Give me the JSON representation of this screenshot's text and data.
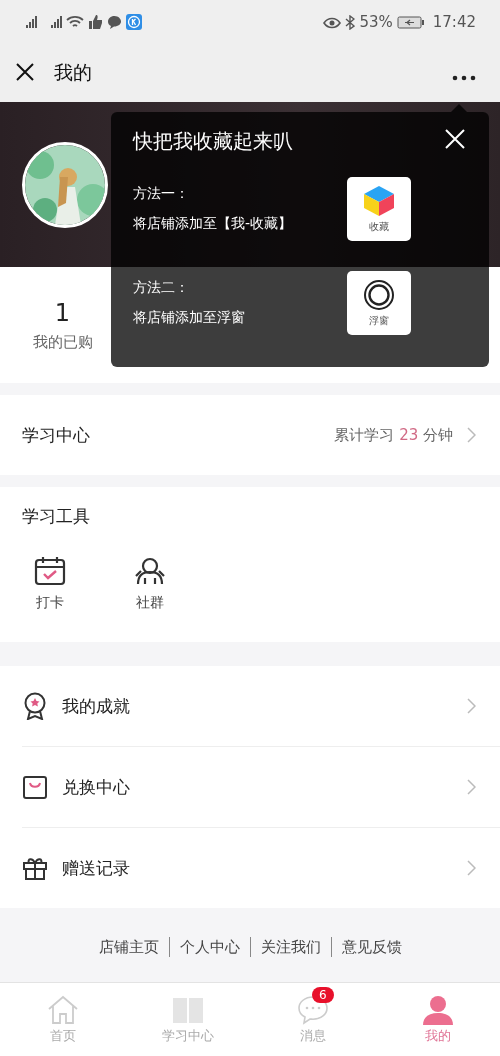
{
  "status_bar": {
    "battery": "53%",
    "time": "17:42"
  },
  "header": {
    "title": "我的"
  },
  "stats": [
    {
      "value": "1",
      "label": "我的已购"
    }
  ],
  "popup": {
    "title": "快把我收藏起来叭",
    "methods": [
      {
        "label": "方法一：",
        "text": "将店铺添加至【我-收藏】",
        "icon_label": "收藏",
        "kind": "cube"
      },
      {
        "label": "方法二：",
        "text": "将店铺添加至浮窗",
        "icon_label": "浮窗",
        "kind": "ring"
      }
    ]
  },
  "learning": {
    "title": "学习中心",
    "prefix": "累计学习",
    "minutes": "23",
    "suffix": "分钟"
  },
  "tools": {
    "title": "学习工具",
    "items": [
      {
        "label": "打卡",
        "kind": "checkin"
      },
      {
        "label": "社群",
        "kind": "group"
      }
    ]
  },
  "menu": [
    {
      "label": "我的成就",
      "kind": "medal"
    },
    {
      "label": "兑换中心",
      "kind": "bag"
    },
    {
      "label": "赠送记录",
      "kind": "gift"
    }
  ],
  "footer_links": [
    "店铺主页",
    "个人中心",
    "关注我们",
    "意见反馈"
  ],
  "tabs": [
    {
      "label": "首页",
      "kind": "home",
      "selected": false
    },
    {
      "label": "学习中心",
      "kind": "book",
      "selected": false
    },
    {
      "label": "消息",
      "kind": "chat",
      "selected": false,
      "badge": "6"
    },
    {
      "label": "我的",
      "kind": "user",
      "selected": true
    }
  ]
}
